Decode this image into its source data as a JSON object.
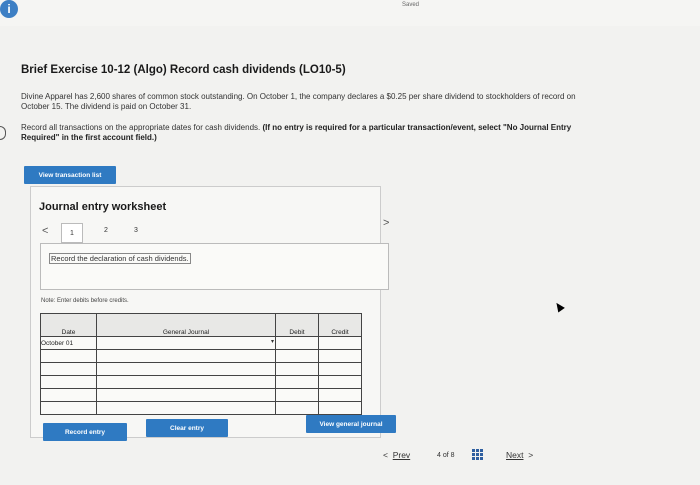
{
  "header": {
    "saved_label": "Saved",
    "info_icon": "info-icon"
  },
  "exercise": {
    "title": "Brief Exercise 10-12 (Algo) Record cash dividends (LO10-5)",
    "paragraph1": "Divine Apparel has 2,600 shares of common stock outstanding. On October 1, the company declares a $0.25 per share dividend to stockholders of record on October 15. The dividend is paid on October 31.",
    "paragraph2_plain": "Record all transactions on the appropriate dates for cash dividends. ",
    "paragraph2_bold": "(If no entry is required for a particular transaction/event, select \"No Journal Entry Required\" in the first account field.)"
  },
  "buttons": {
    "view_transaction_list": "View transaction list",
    "record_entry": "Record entry",
    "clear_entry": "Clear entry",
    "view_general_journal": "View general journal"
  },
  "worksheet": {
    "title": "Journal entry worksheet",
    "tabs": [
      "1",
      "2",
      "3"
    ],
    "prev_arrow": "<",
    "next_arrow": ">",
    "instruction": "Record the declaration of cash dividends.",
    "note": "Note: Enter debits before credits.",
    "columns": {
      "date": "Date",
      "account": "General Journal",
      "debit": "Debit",
      "credit": "Credit"
    },
    "rows": [
      {
        "date": "October 01",
        "account": "",
        "debit": "",
        "credit": ""
      },
      {
        "date": "",
        "account": "",
        "debit": "",
        "credit": ""
      },
      {
        "date": "",
        "account": "",
        "debit": "",
        "credit": ""
      },
      {
        "date": "",
        "account": "",
        "debit": "",
        "credit": ""
      },
      {
        "date": "",
        "account": "",
        "debit": "",
        "credit": ""
      },
      {
        "date": "",
        "account": "",
        "debit": "",
        "credit": ""
      }
    ]
  },
  "footer": {
    "prev": "Prev",
    "page_current": "4",
    "page_of": "of",
    "page_total": "8",
    "next": "Next"
  },
  "colors": {
    "accent": "#2f7ac2",
    "background": "#f2f2f0"
  }
}
